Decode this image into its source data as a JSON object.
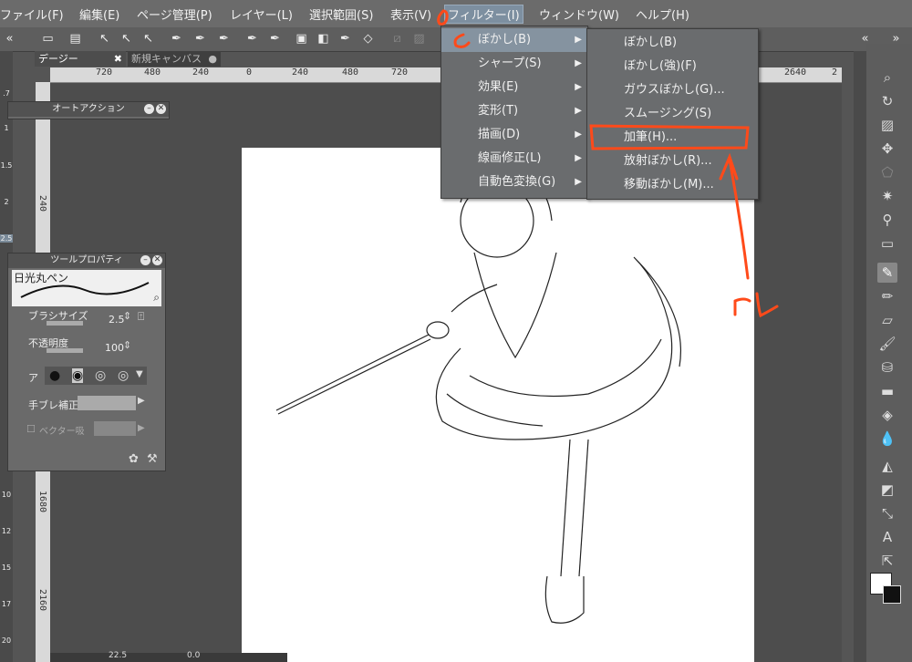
{
  "menubar": {
    "items": [
      "ファイル(F)",
      "編集(E)",
      "ページ管理(P)",
      "レイヤー(L)",
      "選択範囲(S)",
      "表示(V)",
      "フィルター(I)",
      "ウィンドウ(W)",
      "ヘルプ(H)"
    ]
  },
  "tabs": [
    "デージー",
    "新規キャンバス"
  ],
  "ruler": {
    "top_ticks": [
      "720",
      "480",
      "240",
      "0",
      "240",
      "480",
      "720",
      "2640",
      "2"
    ],
    "left_ticks": [
      "240",
      "1680",
      "2160"
    ]
  },
  "left_strip": {
    "sizes": [
      ".7",
      "1",
      "1.5",
      "2",
      "2.5",
      "10",
      "12",
      "15",
      "17",
      "20"
    ]
  },
  "auto_action": {
    "title": "オートアクション"
  },
  "tool_property": {
    "title": "ツールプロパティ",
    "tool_name": "日光丸ペン",
    "brush_size_label": "ブラシサイズ",
    "brush_size_value": "2.5",
    "opacity_label": "不透明度",
    "opacity_value": "100",
    "antialias_label": "ア",
    "stabilization_label": "手ブレ補正",
    "vector_label": "ベクター吸"
  },
  "filter_menu": {
    "items": [
      "ぼかし(B)",
      "シャープ(S)",
      "効果(E)",
      "変形(T)",
      "描画(D)",
      "線画修正(L)",
      "自動色変換(G)"
    ],
    "highlighted": 0
  },
  "blur_submenu": {
    "items": [
      "ぼかし(B)",
      "ぼかし(強)(F)",
      "ガウスぼかし(G)...",
      "スムージング(S)",
      "加筆(H)...",
      "放射ぼかし(R)...",
      "移動ぼかし(M)..."
    ],
    "circled_index": 4
  },
  "annotation": {
    "text": "コレ",
    "color": "#ff4a1a"
  },
  "colors": {
    "menubar": "#6b6b6b",
    "menu_bg": "#6a6c6e",
    "highlight": "#8593a0",
    "annotation": "#ff4a1a"
  },
  "statusbar": {
    "zoom": "22.5",
    "angle": "0.0"
  }
}
